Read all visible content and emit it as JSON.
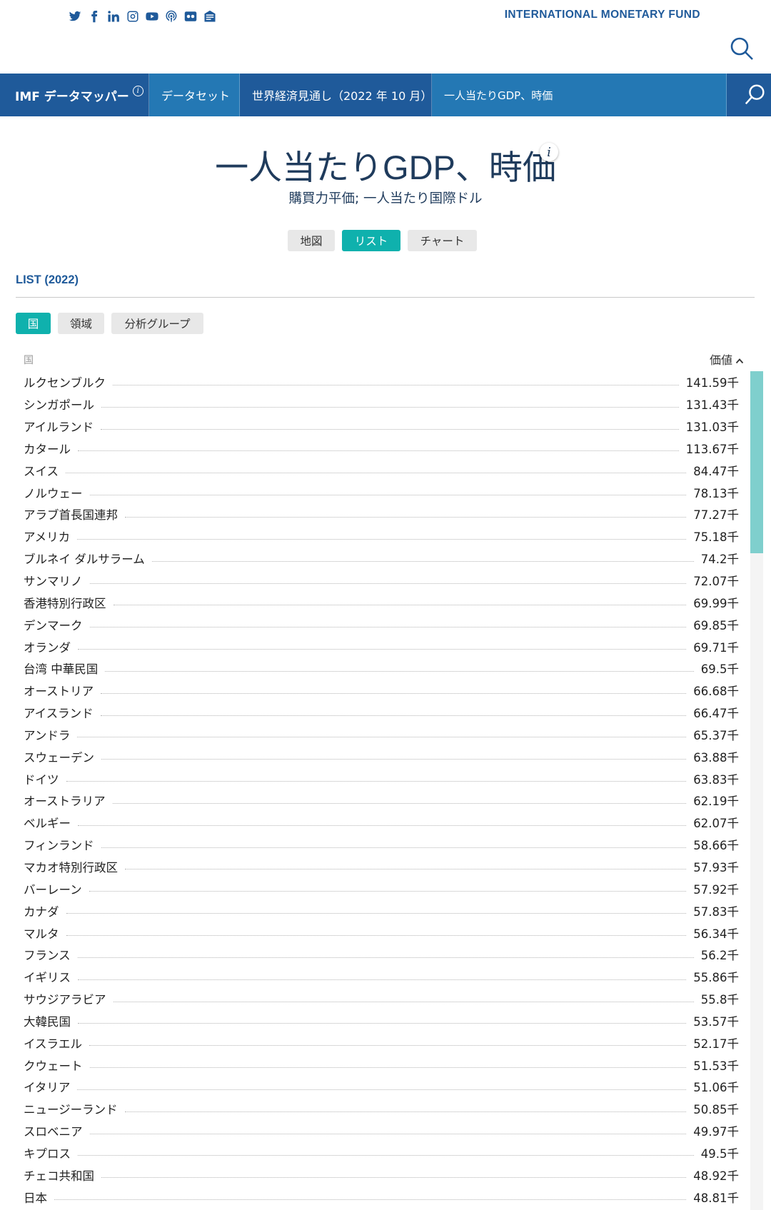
{
  "header": {
    "org_name": "INTERNATIONAL MONETARY FUND",
    "social_icons": [
      "twitter-icon",
      "facebook-icon",
      "linkedin-icon",
      "instagram-icon",
      "youtube-icon",
      "podcast-icon",
      "flickr-icon",
      "newsletter-icon"
    ]
  },
  "nav": {
    "brand": "IMF データマッパー",
    "brand_info": "i",
    "dataset": "データセット",
    "weo": "世界経済見通し（2022 年 10 月）",
    "indicator": "一人当たりGDP、時価"
  },
  "page": {
    "title": "一人当たりGDP、時価",
    "title_info": "i",
    "subtitle": "購買力平価; 一人当たり国際ドル"
  },
  "view_buttons": {
    "map": "地図",
    "list": "リスト",
    "chart": "チャート"
  },
  "list_heading": "LIST (2022)",
  "filter_buttons": {
    "country": "国",
    "region": "領域",
    "group": "分析グループ"
  },
  "table": {
    "col_country": "国",
    "col_value": "価値",
    "rows": [
      {
        "name": "ルクセンブルク",
        "value": "141.59千"
      },
      {
        "name": "シンガポール",
        "value": "131.43千"
      },
      {
        "name": "アイルランド",
        "value": "131.03千"
      },
      {
        "name": "カタール",
        "value": "113.67千"
      },
      {
        "name": "スイス",
        "value": "84.47千"
      },
      {
        "name": "ノルウェー",
        "value": "78.13千"
      },
      {
        "name": "アラブ首長国連邦",
        "value": "77.27千"
      },
      {
        "name": "アメリカ",
        "value": "75.18千"
      },
      {
        "name": "ブルネイ ダルサラーム",
        "value": "74.2千"
      },
      {
        "name": "サンマリノ",
        "value": "72.07千"
      },
      {
        "name": "香港特別行政区",
        "value": "69.99千"
      },
      {
        "name": "デンマーク",
        "value": "69.85千"
      },
      {
        "name": "オランダ",
        "value": "69.71千"
      },
      {
        "name": "台湾 中華民国",
        "value": "69.5千"
      },
      {
        "name": "オーストリア",
        "value": "66.68千"
      },
      {
        "name": "アイスランド",
        "value": "66.47千"
      },
      {
        "name": "アンドラ",
        "value": "65.37千"
      },
      {
        "name": "スウェーデン",
        "value": "63.88千"
      },
      {
        "name": "ドイツ",
        "value": "63.83千"
      },
      {
        "name": "オーストラリア",
        "value": "62.19千"
      },
      {
        "name": "ベルギー",
        "value": "62.07千"
      },
      {
        "name": "フィンランド",
        "value": "58.66千"
      },
      {
        "name": "マカオ特別行政区",
        "value": "57.93千"
      },
      {
        "name": "バーレーン",
        "value": "57.92千"
      },
      {
        "name": "カナダ",
        "value": "57.83千"
      },
      {
        "name": "マルタ",
        "value": "56.34千"
      },
      {
        "name": "フランス",
        "value": "56.2千"
      },
      {
        "name": "イギリス",
        "value": "55.86千"
      },
      {
        "name": "サウジアラビア",
        "value": "55.8千"
      },
      {
        "name": "大韓民国",
        "value": "53.57千"
      },
      {
        "name": "イスラエル",
        "value": "52.17千"
      },
      {
        "name": "クウェート",
        "value": "51.53千"
      },
      {
        "name": "イタリア",
        "value": "51.06千"
      },
      {
        "name": "ニュージーランド",
        "value": "50.85千"
      },
      {
        "name": "スロベニア",
        "value": "49.97千"
      },
      {
        "name": "キプロス",
        "value": "49.5千"
      },
      {
        "name": "チェコ共和国",
        "value": "48.92千"
      },
      {
        "name": "日本",
        "value": "48.81千"
      }
    ]
  },
  "colors": {
    "brand_dark": "#1f5a9a",
    "brand_light": "#2478b4",
    "accent": "#0fb1ad",
    "title": "#1f3b5c"
  }
}
